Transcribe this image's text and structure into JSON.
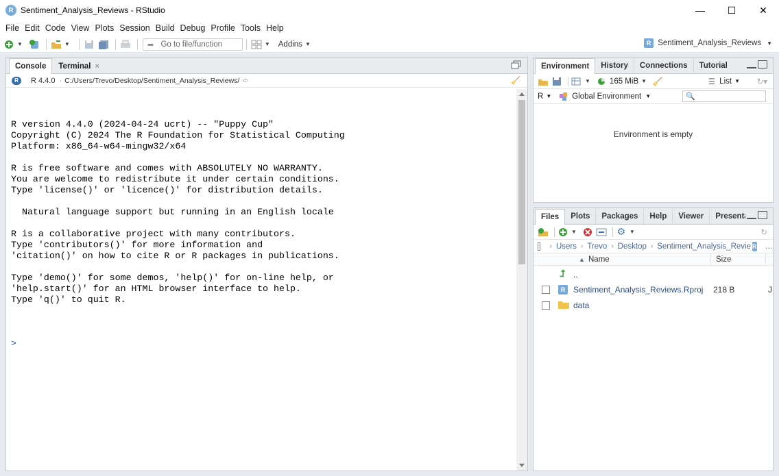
{
  "window": {
    "title": "Sentiment_Analysis_Reviews - RStudio",
    "app_icon": "R",
    "controls": {
      "minimize": "—",
      "maximize": "☐",
      "close": "✕"
    }
  },
  "menu": [
    "File",
    "Edit",
    "Code",
    "View",
    "Plots",
    "Session",
    "Build",
    "Debug",
    "Profile",
    "Tools",
    "Help"
  ],
  "toolbar": {
    "goto_placeholder": "Go to file/function",
    "addins_label": "Addins",
    "project_label": "Sentiment_Analysis_Reviews"
  },
  "left_pane": {
    "tabs": [
      {
        "label": "Console",
        "active": true
      },
      {
        "label": "Terminal",
        "active": false,
        "close": "×"
      }
    ],
    "r_version": "R 4.4.0",
    "path": "C:/Users/Trevo/Desktop/Sentiment_Analysis_Reviews/",
    "console_lines": [
      "R version 4.4.0 (2024-04-24 ucrt) -- \"Puppy Cup\"",
      "Copyright (C) 2024 The R Foundation for Statistical Computing",
      "Platform: x86_64-w64-mingw32/x64",
      "",
      "R is free software and comes with ABSOLUTELY NO WARRANTY.",
      "You are welcome to redistribute it under certain conditions.",
      "Type 'license()' or 'licence()' for distribution details.",
      "",
      "  Natural language support but running in an English locale",
      "",
      "R is a collaborative project with many contributors.",
      "Type 'contributors()' for more information and",
      "'citation()' on how to cite R or R packages in publications.",
      "",
      "Type 'demo()' for some demos, 'help()' for on-line help, or",
      "'help.start()' for an HTML browser interface to help.",
      "Type 'q()' to quit R."
    ],
    "prompt": ">"
  },
  "env_pane": {
    "tabs": [
      "Environment",
      "History",
      "Connections",
      "Tutorial"
    ],
    "memory": "165 MiB",
    "list_label": "List",
    "language": "R",
    "scope": "Global Environment",
    "empty_message": "Environment is empty"
  },
  "files_pane": {
    "tabs": [
      "Files",
      "Plots",
      "Packages",
      "Help",
      "Viewer",
      "Presentation"
    ],
    "breadcrumb": [
      "Users",
      "Trevo",
      "Desktop",
      "Sentiment_Analysis_Revie"
    ],
    "columns": {
      "name": "Name",
      "size": "Size"
    },
    "parent": "..",
    "files": [
      {
        "name": "Sentiment_Analysis_Reviews.Rproj",
        "size": "218 B",
        "extra": "J",
        "icon": "rproj-icon"
      },
      {
        "name": "data",
        "size": "",
        "extra": "",
        "icon": "folder-icon"
      }
    ]
  },
  "colors": {
    "accent_blue": "#75aadb",
    "pane_border": "#c3c9cf",
    "workspace_bg": "#e6eaee",
    "link_blue": "#2c4e8a",
    "prompt_blue": "#2255cc"
  }
}
